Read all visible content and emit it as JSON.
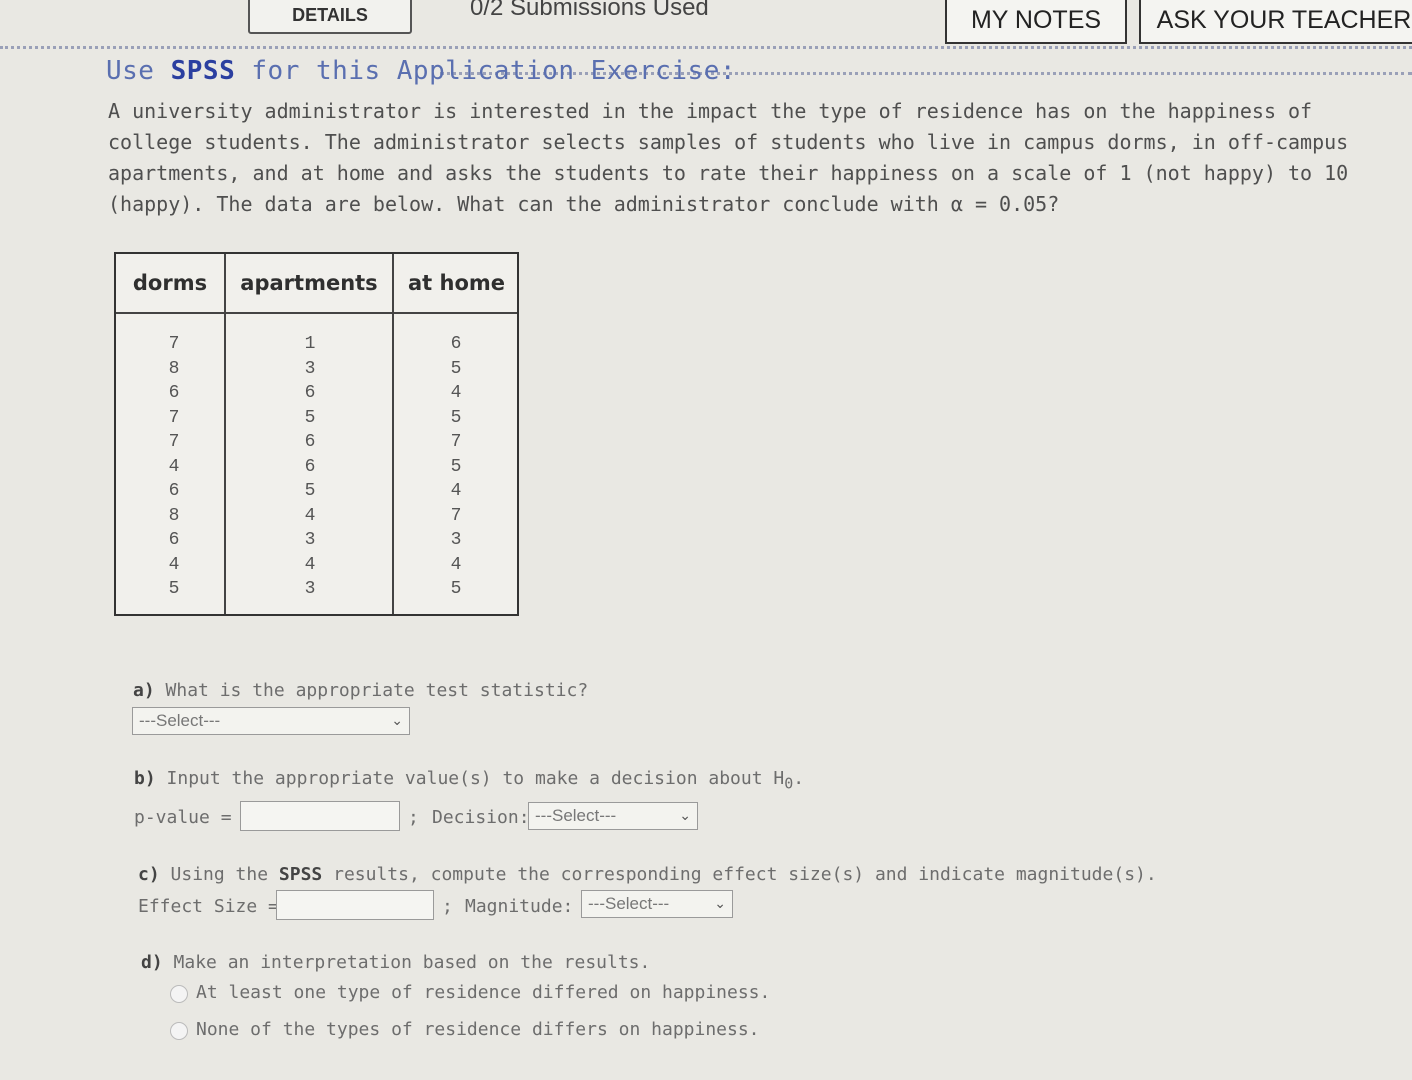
{
  "topbar": {
    "details_label": "DETAILS",
    "submissions": "0/2 Submissions Used",
    "my_notes": "MY NOTES",
    "ask_teacher": "ASK YOUR TEACHER"
  },
  "problem": {
    "heading_pre": "Use ",
    "heading_bold": "SPSS",
    "heading_post": " for this Application Exercise:",
    "paragraph": "A university administrator is interested in the impact the type of residence has on the happiness of college students.  The administrator selects samples of students who live in campus dorms, in off-campus apartments, and at home and asks the students to rate their happiness on a scale of 1 (not happy) to 10 (happy).  The data are below.  What can the administrator conclude with α = 0.05?"
  },
  "table": {
    "headers": [
      "dorms",
      "apartments",
      "at home"
    ],
    "columns": [
      [
        "7",
        "8",
        "6",
        "7",
        "7",
        "4",
        "6",
        "8",
        "6",
        "4",
        "5"
      ],
      [
        "1",
        "3",
        "6",
        "5",
        "6",
        "6",
        "5",
        "4",
        "3",
        "4",
        "3"
      ],
      [
        "6",
        "5",
        "4",
        "5",
        "7",
        "5",
        "4",
        "7",
        "3",
        "4",
        "5"
      ]
    ]
  },
  "questions": {
    "a": {
      "letter": "a)",
      "text": " What is the appropriate test statistic?",
      "select": "---Select---"
    },
    "b": {
      "letter": "b)",
      "text": " Input the appropriate value(s) to make a decision about H",
      "sub": "0",
      "tail": ".",
      "pvalue_label": "p-value =",
      "sep": ";",
      "decision_label": "Decision:",
      "select": "---Select---"
    },
    "c": {
      "letter": "c)",
      "text_pre": " Using the ",
      "bold": "SPSS",
      "text_post": " results, compute the corresponding effect size(s) and indicate magnitude(s).",
      "effect_label": "Effect Size =",
      "sep": ";",
      "magnitude_label": "Magnitude:",
      "select": "---Select---"
    },
    "d": {
      "letter": "d)",
      "text": " Make an interpretation based on the results.",
      "options": [
        "At least one type of residence differed on happiness.",
        "None of the types of residence differs on happiness."
      ]
    }
  }
}
